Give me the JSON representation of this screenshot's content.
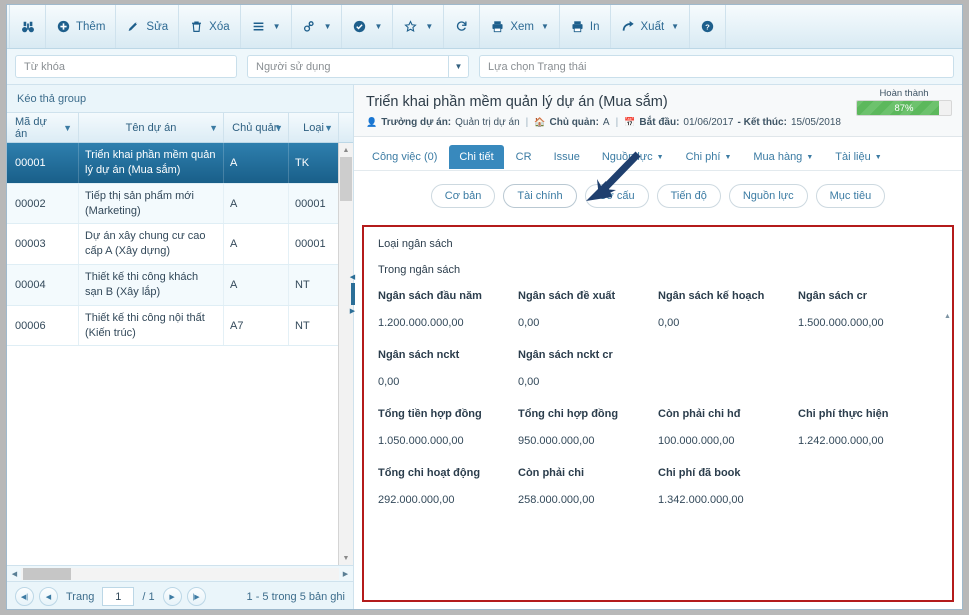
{
  "toolbar": {
    "buttons": [
      {
        "id": "search",
        "icon": "binoculars-icon",
        "label": "",
        "caret": false
      },
      {
        "id": "add",
        "icon": "plus-circle-icon",
        "label": "Thêm",
        "caret": false
      },
      {
        "id": "edit",
        "icon": "pencil-icon",
        "label": "Sửa",
        "caret": false
      },
      {
        "id": "delete",
        "icon": "trash-icon",
        "label": "Xóa",
        "caret": false
      },
      {
        "id": "menu",
        "icon": "list-icon",
        "label": "",
        "caret": true
      },
      {
        "id": "link",
        "icon": "link-icon",
        "label": "",
        "caret": true
      },
      {
        "id": "check",
        "icon": "check-circle-icon",
        "label": "",
        "caret": true
      },
      {
        "id": "star",
        "icon": "star-icon",
        "label": "",
        "caret": true
      },
      {
        "id": "refresh",
        "icon": "refresh-icon",
        "label": "",
        "caret": false
      },
      {
        "id": "view",
        "icon": "printer-icon",
        "label": "Xem",
        "caret": true
      },
      {
        "id": "print",
        "icon": "printer-icon",
        "label": "In",
        "caret": false
      },
      {
        "id": "export",
        "icon": "share-arrow-icon",
        "label": "Xuất",
        "caret": true
      },
      {
        "id": "help",
        "icon": "question-circle-icon",
        "label": "",
        "caret": false
      }
    ]
  },
  "filterbar": {
    "keyword_placeholder": "Từ khóa",
    "keyword_value": "",
    "user_placeholder": "Người sử dụng",
    "user_value": "",
    "status_placeholder": "Lựa chọn Trạng thái",
    "status_value": ""
  },
  "grid": {
    "group_bar": "Kéo thả group",
    "columns": [
      "Mã dự án",
      "Tên dự án",
      "Chủ quản",
      "Loại"
    ],
    "rows": [
      {
        "code": "00001",
        "name": "Triển khai phần mềm quản lý dự án (Mua sắm)",
        "owner": "A",
        "type": "TK",
        "selected": true
      },
      {
        "code": "00002",
        "name": "Tiếp thị sản phẩm mới (Marketing)",
        "owner": "A",
        "type": "00001",
        "selected": false
      },
      {
        "code": "00003",
        "name": "Dự án xây chung cư cao cấp A (Xây dựng)",
        "owner": "A",
        "type": "00001",
        "selected": false
      },
      {
        "code": "00004",
        "name": "Thiết kế thi công khách sạn B (Xây lắp)",
        "owner": "A",
        "type": "NT",
        "selected": false
      },
      {
        "code": "00006",
        "name": "Thiết kế thi công nội thất (Kiến trúc)",
        "owner": "A7",
        "type": "NT",
        "selected": false
      }
    ],
    "pager": {
      "page_label": "Trang",
      "page_value": "1",
      "page_total": "/ 1",
      "record_info": "1 - 5 trong 5 bản ghi"
    }
  },
  "project": {
    "title": "Triển khai phần mềm quản lý dự án (Mua sắm)",
    "meta": {
      "manager_label": "Trưởng dự án:",
      "manager_value": "Quản trị dự án",
      "owner_label": "Chủ quản:",
      "owner_value": "A",
      "date_label": "Bắt đầu:",
      "start": "01/06/2017",
      "end_label": "- Kết thúc:",
      "end": "15/05/2018"
    },
    "progress": {
      "label": "Hoàn thành",
      "percent": "87%",
      "value": 87,
      "color": "#5cb85c"
    }
  },
  "tabs": [
    {
      "label": "Công việc (0)",
      "caret": false,
      "active": false
    },
    {
      "label": "Chi tiết",
      "caret": false,
      "active": true
    },
    {
      "label": "CR",
      "caret": false,
      "active": false
    },
    {
      "label": "Issue",
      "caret": false,
      "active": false
    },
    {
      "label": "Nguồn lực",
      "caret": true,
      "active": false
    },
    {
      "label": "Chi phí",
      "caret": true,
      "active": false
    },
    {
      "label": "Mua hàng",
      "caret": true,
      "active": false
    },
    {
      "label": "Tài liệu",
      "caret": true,
      "active": false
    }
  ],
  "subtabs": [
    {
      "label": "Cơ bản",
      "selected": false
    },
    {
      "label": "Tài chính",
      "selected": true
    },
    {
      "label": "Cơ cấu",
      "selected": false
    },
    {
      "label": "Tiến độ",
      "selected": false
    },
    {
      "label": "Nguồn lực",
      "selected": false
    },
    {
      "label": "Mục tiêu",
      "selected": false
    }
  ],
  "detail": {
    "budget_type_label": "Loại ngân sách",
    "budget_type_value": "Trong ngân sách",
    "groups": [
      {
        "fields": [
          {
            "label": "Ngân sách đầu năm",
            "value": "1.200.000.000,00"
          },
          {
            "label": "Ngân sách đề xuất",
            "value": "0,00"
          },
          {
            "label": "Ngân sách kế hoạch",
            "value": "0,00"
          },
          {
            "label": "Ngân sách cr",
            "value": "1.500.000.000,00"
          }
        ]
      },
      {
        "fields": [
          {
            "label": "Ngân sách nckt",
            "value": "0,00"
          },
          {
            "label": "Ngân sách nckt cr",
            "value": "0,00"
          },
          {
            "label": "",
            "value": ""
          },
          {
            "label": "",
            "value": ""
          }
        ]
      },
      {
        "fields": [
          {
            "label": "Tổng tiền hợp đồng",
            "value": "1.050.000.000,00"
          },
          {
            "label": "Tổng chi hợp đồng",
            "value": "950.000.000,00"
          },
          {
            "label": "Còn phải chi hđ",
            "value": "100.000.000,00"
          },
          {
            "label": "Chi phí thực hiện",
            "value": "1.242.000.000,00"
          }
        ]
      },
      {
        "fields": [
          {
            "label": "Tổng chi hoạt động",
            "value": "292.000.000,00"
          },
          {
            "label": "Còn phải chi",
            "value": "258.000.000,00"
          },
          {
            "label": "Chi phí đã book",
            "value": "1.342.000.000,00"
          },
          {
            "label": "",
            "value": ""
          }
        ]
      }
    ]
  },
  "colors": {
    "accent": "#3889bd",
    "highlight_border": "#b41b1b",
    "progress": "#5cb85c",
    "annotation_arrow": "#1f3f6e"
  }
}
